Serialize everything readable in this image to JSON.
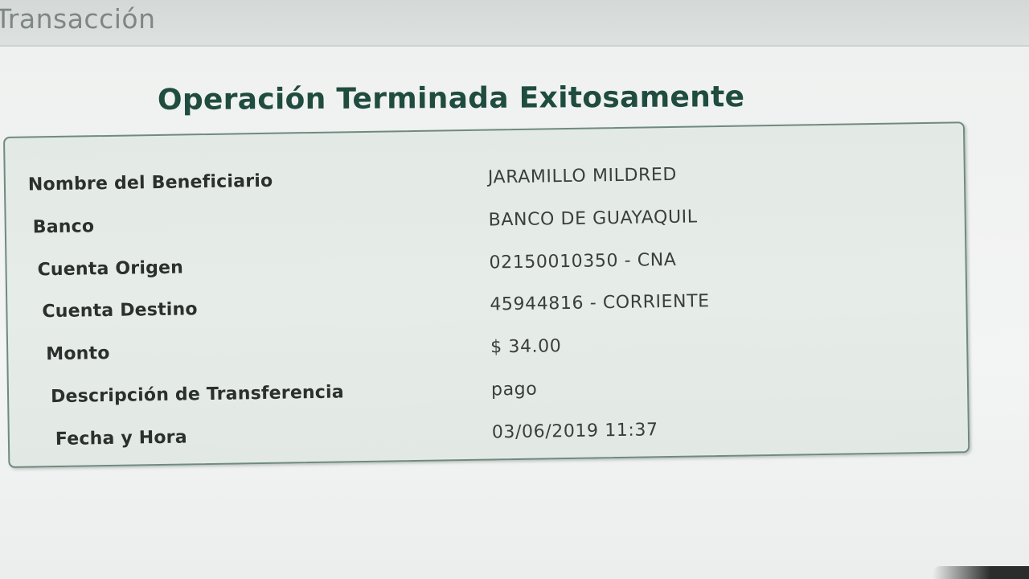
{
  "header": {
    "title": "Transacción"
  },
  "result": {
    "title": "Operación Terminada Exitosamente"
  },
  "details": [
    {
      "label": "Nombre del Beneficiario",
      "value": "JARAMILLO MILDRED"
    },
    {
      "label": "Banco",
      "value": "BANCO DE GUAYAQUIL"
    },
    {
      "label": "Cuenta Origen",
      "value": "02150010350 - CNA"
    },
    {
      "label": "Cuenta Destino",
      "value": "45944816 - CORRIENTE"
    },
    {
      "label": "Monto",
      "value": "$ 34.00"
    },
    {
      "label": "Descripción de Transferencia",
      "value": "pago"
    },
    {
      "label": "Fecha y Hora",
      "value": "03/06/2019 11:37"
    }
  ]
}
